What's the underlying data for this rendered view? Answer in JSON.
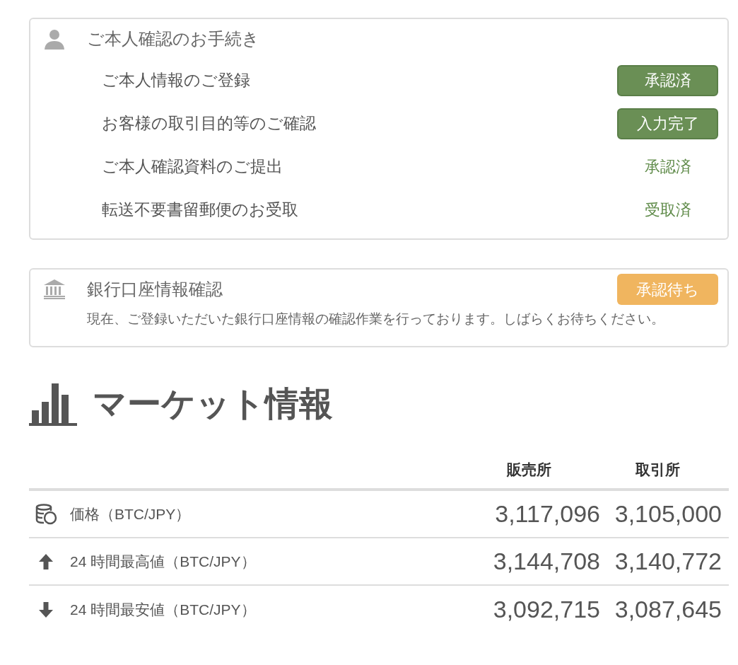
{
  "identity_card": {
    "title": "ご本人確認のお手続き",
    "steps": [
      {
        "label": "ご本人情報のご登録",
        "status": {
          "label": "承認済",
          "kind": "badge"
        }
      },
      {
        "label": "お客様の取引目的等のご確認",
        "status": {
          "label": "入力完了",
          "kind": "badge"
        }
      },
      {
        "label": "ご本人確認資料のご提出",
        "status": {
          "label": "承認済",
          "kind": "text"
        }
      },
      {
        "label": "転送不要書留郵便のお受取",
        "status": {
          "label": "受取済",
          "kind": "text"
        }
      }
    ]
  },
  "bank_card": {
    "title": "銀行口座情報確認",
    "status": {
      "label": "承認待ち",
      "kind": "pending"
    },
    "message": "現在、ご登録いただいた銀行口座情報の確認作業を行っております。しばらくお待ちください。"
  },
  "market": {
    "heading": "マーケット情報",
    "columns": [
      "販売所",
      "取引所"
    ],
    "rows": [
      {
        "kind": "price",
        "label": "価格（BTC/JPY）",
        "values": [
          "3,117,096",
          "3,105,000"
        ]
      },
      {
        "kind": "high",
        "label": "24 時間最高値（BTC/JPY）",
        "values": [
          "3,144,708",
          "3,140,772"
        ]
      },
      {
        "kind": "low",
        "label": "24 時間最安値（BTC/JPY）",
        "values": [
          "3,092,715",
          "3,087,645"
        ]
      }
    ]
  }
}
